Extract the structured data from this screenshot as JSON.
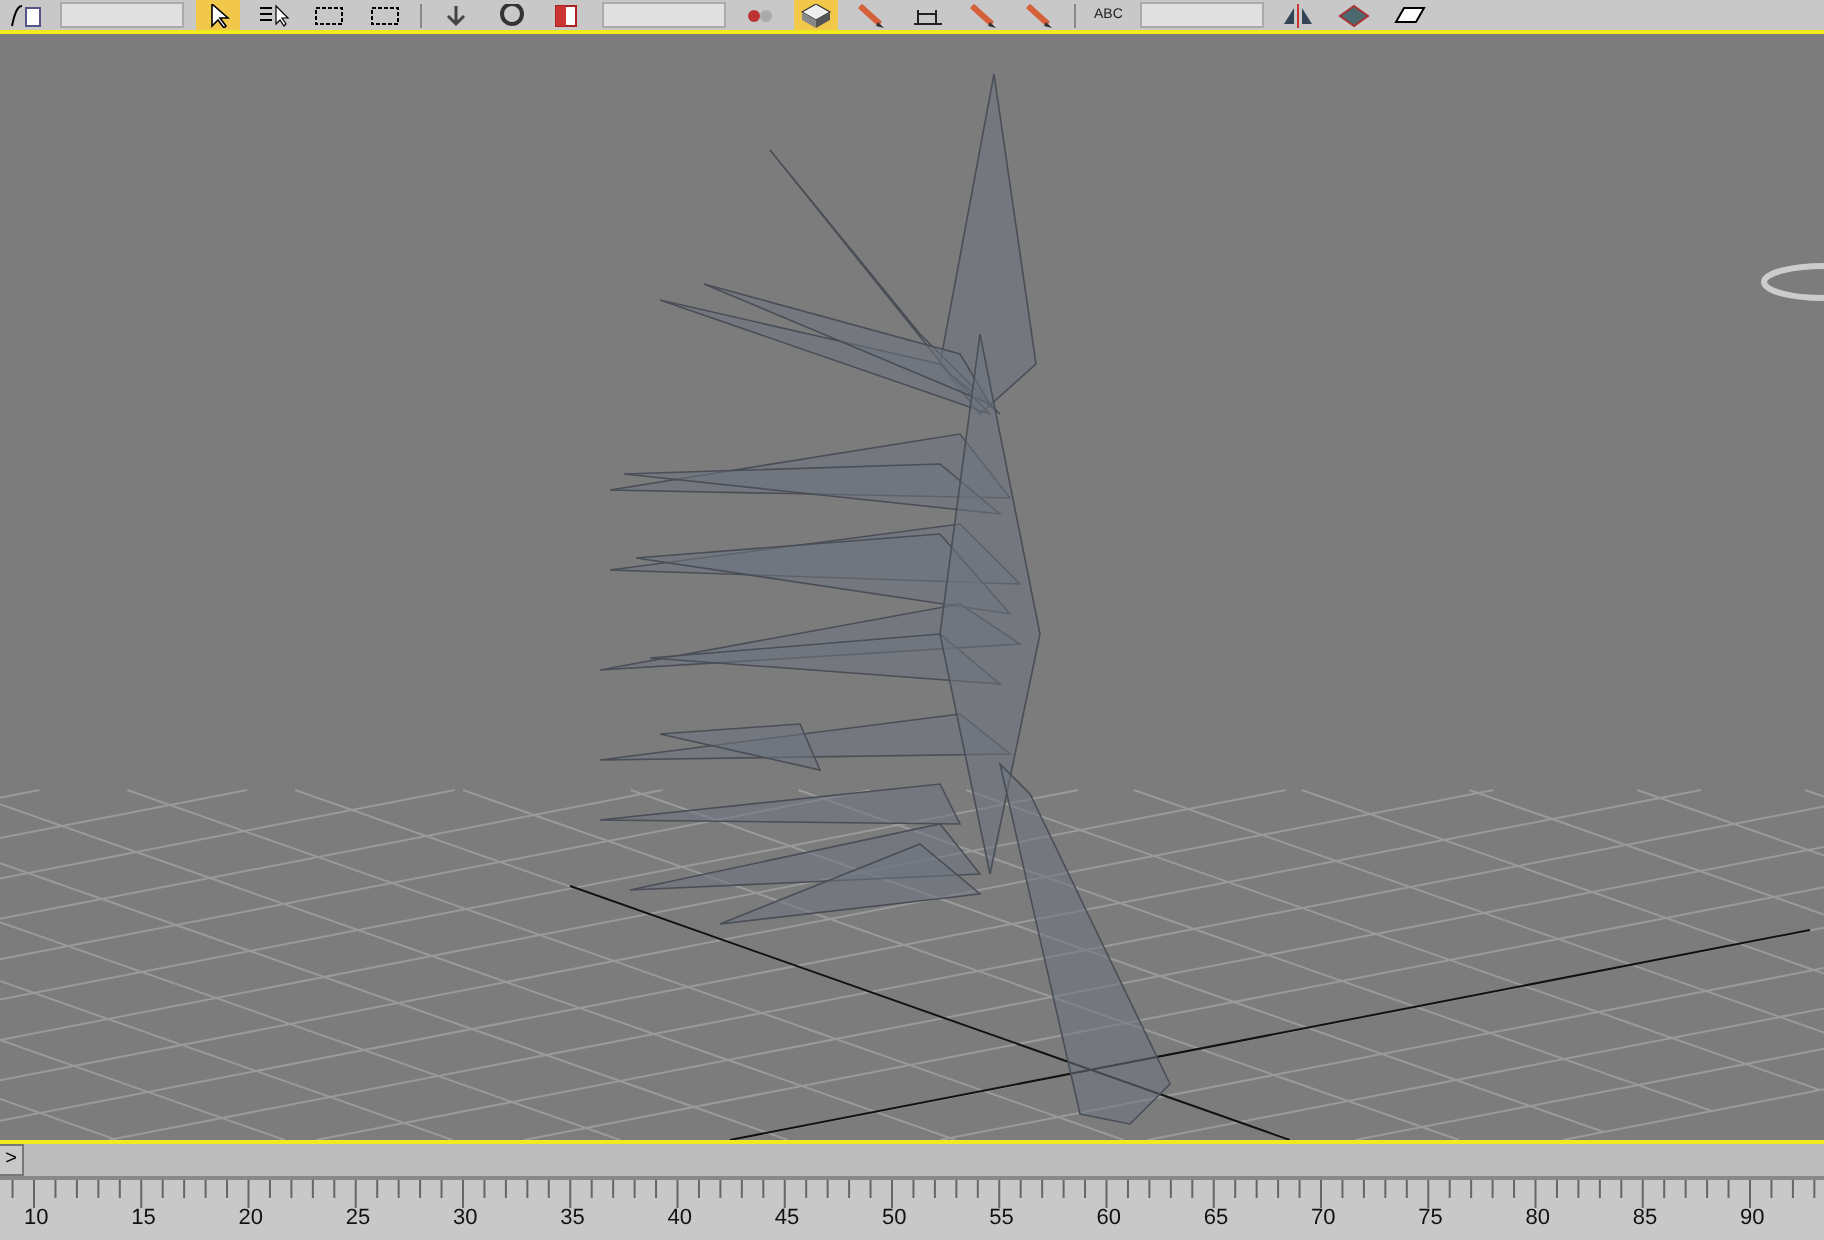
{
  "toolbar": {
    "items": [
      {
        "kind": "curve",
        "selected": false
      },
      {
        "kind": "field"
      },
      {
        "kind": "cursor",
        "selected": true
      },
      {
        "kind": "listcursor",
        "selected": false
      },
      {
        "kind": "marquee",
        "selected": false
      },
      {
        "kind": "marquee",
        "selected": false
      },
      {
        "kind": "separator"
      },
      {
        "kind": "arrow",
        "selected": false
      },
      {
        "kind": "ring",
        "selected": false
      },
      {
        "kind": "swatch",
        "selected": false
      },
      {
        "kind": "field"
      },
      {
        "kind": "dots",
        "selected": false
      },
      {
        "kind": "cube",
        "selected": true
      },
      {
        "kind": "pencil",
        "selected": false
      },
      {
        "kind": "measure",
        "selected": false
      },
      {
        "kind": "pencil",
        "selected": false
      },
      {
        "kind": "pencil",
        "selected": false
      },
      {
        "kind": "separator"
      },
      {
        "kind": "text",
        "label": "ABC",
        "selected": false
      },
      {
        "kind": "field"
      },
      {
        "kind": "mirror",
        "selected": false
      },
      {
        "kind": "diamond",
        "selected": false
      },
      {
        "kind": "sheet",
        "selected": false
      }
    ]
  },
  "viewport": {
    "active": true
  },
  "timeline": {
    "expand_button": ">",
    "ruler_labels": [
      "10",
      "15",
      "20",
      "25",
      "30",
      "35",
      "40",
      "45",
      "50",
      "55",
      "60",
      "65",
      "70",
      "75",
      "80",
      "85",
      "90"
    ]
  }
}
